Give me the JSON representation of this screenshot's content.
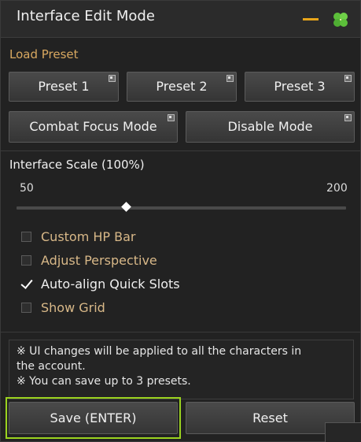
{
  "window": {
    "title": "Interface Edit Mode",
    "minimize_icon": "minimize-icon",
    "app_icon": "clover-icon",
    "accent_color": "#e8a51a"
  },
  "load_preset": {
    "label": "Load Preset",
    "presets": [
      "Preset 1",
      "Preset 2",
      "Preset 3"
    ],
    "modes": [
      "Combat Focus Mode",
      "Disable Mode"
    ]
  },
  "scale": {
    "label": "Interface Scale (100%)",
    "min_label": "50",
    "max_label": "200",
    "min": 50,
    "max": 200,
    "value": 100
  },
  "options": [
    {
      "label": "Custom HP Bar",
      "checked": false
    },
    {
      "label": "Adjust Perspective",
      "checked": false
    },
    {
      "label": "Auto-align Quick Slots",
      "checked": true
    },
    {
      "label": "Show Grid",
      "checked": false
    }
  ],
  "notice": {
    "line1": "※ UI changes will be applied to all the characters in",
    "line2": "the account.",
    "line3": "※ You can save up to 3 presets."
  },
  "footer": {
    "save_label": "Save (ENTER)",
    "reset_label": "Reset",
    "highlight_color": "#9bd31f"
  }
}
